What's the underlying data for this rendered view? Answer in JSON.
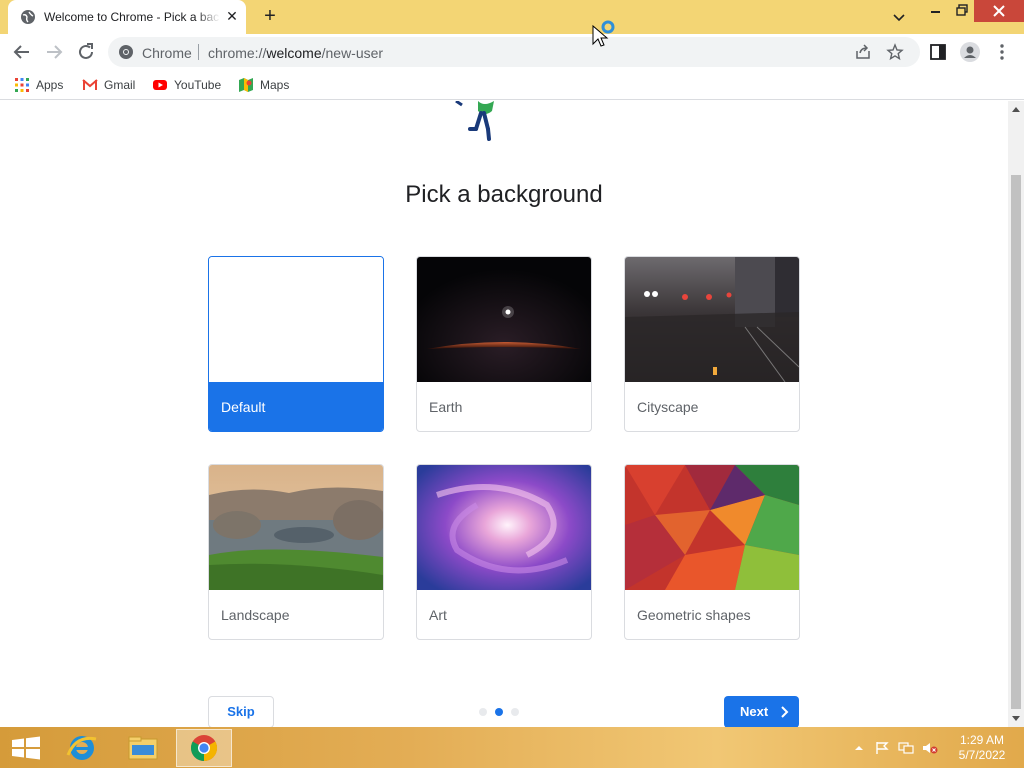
{
  "browser": {
    "tab_title": "Welcome to Chrome - Pick a background",
    "omnibox_chip": "Chrome",
    "omnibox_url_prefix": "chrome://",
    "omnibox_url_host": "welcome",
    "omnibox_url_path": "/new-user"
  },
  "bookmarks": [
    {
      "label": "Apps",
      "icon": "apps-grid-icon"
    },
    {
      "label": "Gmail",
      "icon": "gmail-icon"
    },
    {
      "label": "YouTube",
      "icon": "youtube-icon"
    },
    {
      "label": "Maps",
      "icon": "maps-icon"
    }
  ],
  "page": {
    "heading": "Pick a background",
    "backgrounds": [
      {
        "label": "Default",
        "selected": true
      },
      {
        "label": "Earth",
        "selected": false
      },
      {
        "label": "Cityscape",
        "selected": false
      },
      {
        "label": "Landscape",
        "selected": false
      },
      {
        "label": "Art",
        "selected": false
      },
      {
        "label": "Geometric shapes",
        "selected": false
      }
    ],
    "skip_label": "Skip",
    "next_label": "Next",
    "pager": {
      "count": 3,
      "active_index": 1
    }
  },
  "taskbar": {
    "apps": [
      "start-button",
      "internet-explorer",
      "file-explorer",
      "chrome"
    ],
    "time": "1:29 AM",
    "date": "5/7/2022"
  },
  "colors": {
    "accent": "#1a73e8",
    "titlebar": "#f3d574",
    "close_button": "#c9473a"
  }
}
